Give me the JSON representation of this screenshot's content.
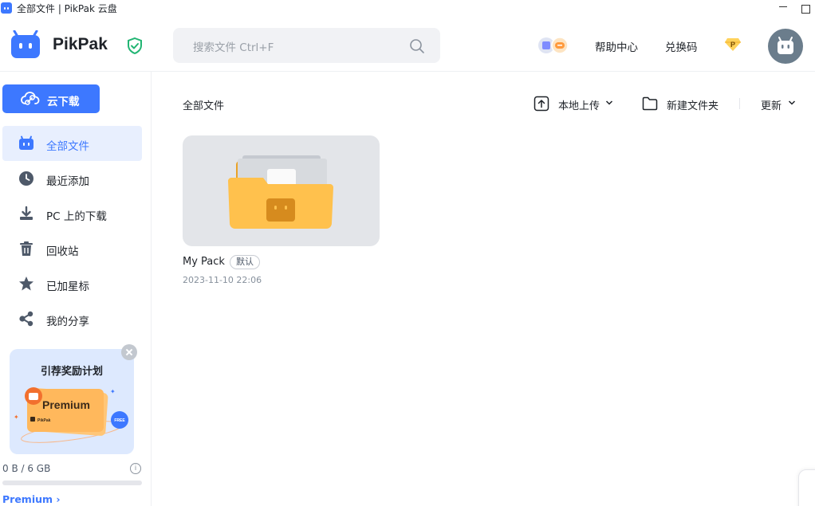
{
  "window": {
    "title": "全部文件 | PikPak 云盘"
  },
  "header": {
    "brand": "PikPak",
    "search_placeholder": "搜索文件 Ctrl+F",
    "help_label": "帮助中心",
    "redeem_label": "兑换码",
    "gem_letter": "P"
  },
  "sidebar": {
    "cloud_download_label": "云下载",
    "items": [
      {
        "label": "全部文件",
        "icon": "drive-icon",
        "active": true
      },
      {
        "label": "最近添加",
        "icon": "clock-icon",
        "active": false
      },
      {
        "label": "PC 上的下载",
        "icon": "download-icon",
        "active": false
      },
      {
        "label": "回收站",
        "icon": "trash-icon",
        "active": false
      },
      {
        "label": "已加星标",
        "icon": "star-icon",
        "active": false
      },
      {
        "label": "我的分享",
        "icon": "share-icon",
        "active": false
      }
    ],
    "promo": {
      "title": "引荐奖励计划",
      "card_text": "Premium",
      "card_brand": "PikPak",
      "badge": "FREE"
    },
    "storage": {
      "text": "0 B / 6 GB",
      "used_fraction": 0
    },
    "premium_link": "Premium",
    "premium_chevron": "›"
  },
  "main": {
    "breadcrumb": "全部文件",
    "toolbar": {
      "upload_label": "本地上传",
      "new_folder_label": "新建文件夹",
      "sort_label": "更新"
    },
    "files": [
      {
        "name": "My Pack",
        "tag": "默认",
        "date": "2023-11-10 22:06"
      }
    ]
  },
  "colors": {
    "accent": "#3d78ff",
    "folder": "#ffc14d",
    "folder_back": "#eaa327",
    "shield": "#22b573"
  }
}
